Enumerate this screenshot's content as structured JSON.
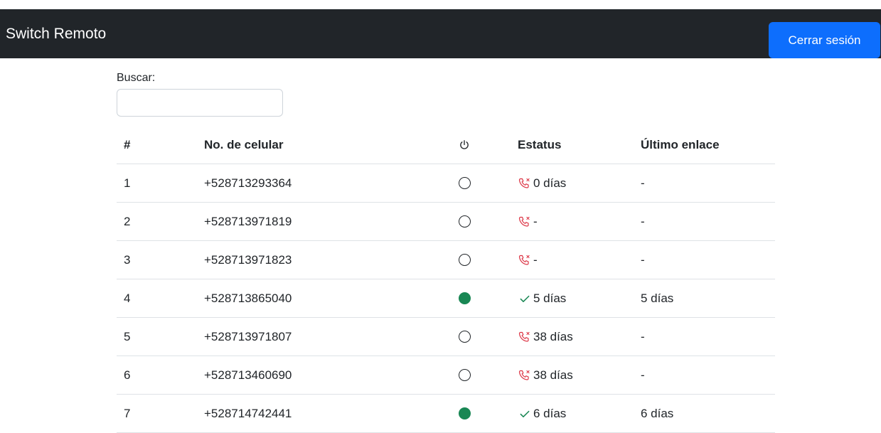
{
  "navbar": {
    "brand": "Switch Remoto",
    "logout_label": "Cerrar sesión"
  },
  "search": {
    "label": "Buscar:",
    "value": ""
  },
  "table": {
    "headers": {
      "num": "#",
      "phone": "No. de celular",
      "power": "power-icon",
      "status": "Estatus",
      "last_link": "Último enlace"
    },
    "rows": [
      {
        "num": "1",
        "phone": "+528713293364",
        "on": false,
        "status_icon": "phone-missed-icon",
        "status": "0 días",
        "last_link": "-"
      },
      {
        "num": "2",
        "phone": "+528713971819",
        "on": false,
        "status_icon": "phone-missed-icon",
        "status": "-",
        "last_link": "-"
      },
      {
        "num": "3",
        "phone": "+528713971823",
        "on": false,
        "status_icon": "phone-missed-icon",
        "status": "-",
        "last_link": "-"
      },
      {
        "num": "4",
        "phone": "+528713865040",
        "on": true,
        "status_icon": "check-icon",
        "status": "5 días",
        "last_link": "5 días"
      },
      {
        "num": "5",
        "phone": "+528713971807",
        "on": false,
        "status_icon": "phone-missed-icon",
        "status": "38 días",
        "last_link": "-"
      },
      {
        "num": "6",
        "phone": "+528713460690",
        "on": false,
        "status_icon": "phone-missed-icon",
        "status": "38 días",
        "last_link": "-"
      },
      {
        "num": "7",
        "phone": "+528714742441",
        "on": true,
        "status_icon": "check-icon",
        "status": "6 días",
        "last_link": "6 días"
      }
    ]
  },
  "colors": {
    "navbar_bg": "#212529",
    "primary": "#0d6efd",
    "status_on": "#198754",
    "status_missed": "#dc3545"
  }
}
